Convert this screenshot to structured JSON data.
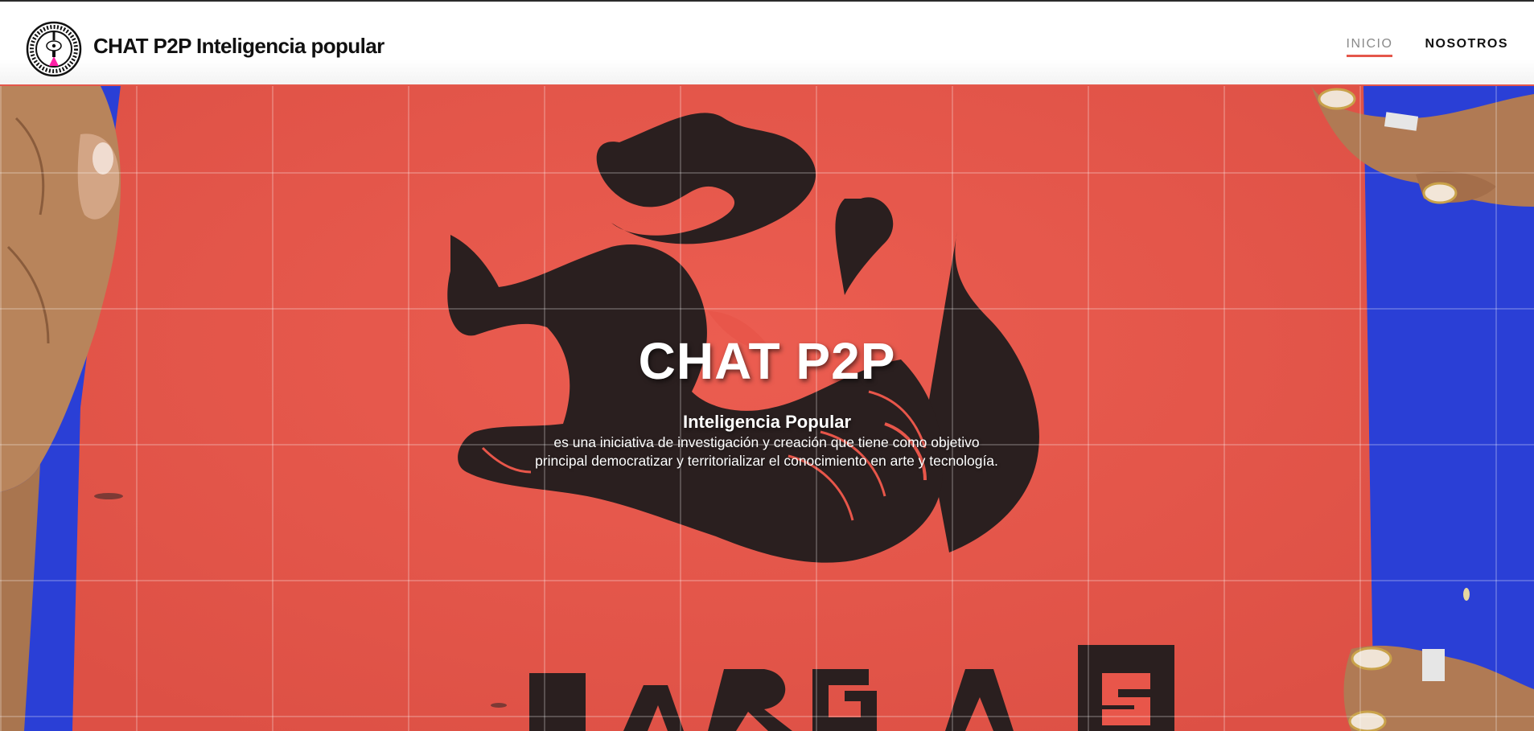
{
  "header": {
    "site_title": "CHAT P2P Inteligencia popular",
    "logo_icon": "circular-seal-logo-icon",
    "nav": [
      {
        "label": "INICIO",
        "active": true
      },
      {
        "label": "NOSOTROS",
        "active": false
      }
    ]
  },
  "hero": {
    "title": "CHAT P2P",
    "subtitle": "Inteligencia Popular",
    "description": "es una iniciativa de investigación y creación que tiene como objetivo principal democratizar y territorializar el conocimiento en arte y tecnología.",
    "background_icon": "red-print-poster-image",
    "colors": {
      "poster": "#e8564a",
      "table": "#2a3fd6",
      "ink": "#2a1f1f",
      "accent": "#e4574b"
    }
  }
}
